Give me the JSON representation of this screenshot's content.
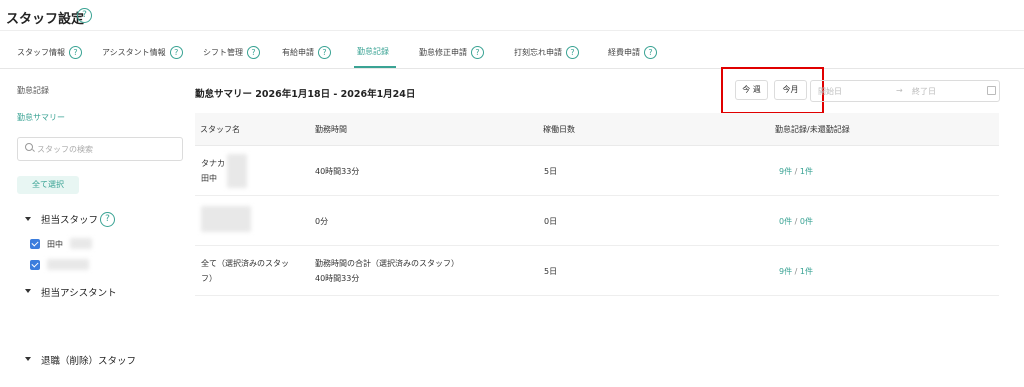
{
  "header": {
    "title": "スタッフ設定",
    "help": "?"
  },
  "tabs": [
    {
      "label": "スタッフ情報",
      "help": "?"
    },
    {
      "label": "アシスタント情報",
      "help": "?"
    },
    {
      "label": "シフト管理",
      "help": "?"
    },
    {
      "label": "有給申請",
      "help": "?"
    },
    {
      "label": "勤怠記録"
    },
    {
      "label": "勤怠修正申請",
      "help": "?"
    },
    {
      "label": "打刻忘れ申請",
      "help": "?"
    },
    {
      "label": "経費申請",
      "help": "?"
    }
  ],
  "sidebar": {
    "heading": "勤怠記録",
    "summary_link": "勤怠サマリー",
    "search_placeholder": "スタッフの検索",
    "select_all": "全て選択",
    "groups": {
      "staff": "担当スタッフ",
      "assistant": "担当アシスタント",
      "retired": "退職（削除）スタッフ"
    },
    "staff_items": [
      {
        "label": "田中"
      }
    ],
    "help": "?"
  },
  "main": {
    "summary_title": "勤怠サマリー 2026年1月18日 - 2026年1月24日",
    "range_buttons": {
      "this_week": "今 週",
      "this_month": "今月"
    },
    "date_range": {
      "start_placeholder": "開始日",
      "arrow": "→",
      "end_placeholder": "終了日"
    },
    "columns": [
      "スタッフ名",
      "勤務時間",
      "稼働日数",
      "勤怠記録/未還勤記録"
    ],
    "rows": [
      {
        "name_line1": "タナカ",
        "name_line2": "田中",
        "hours": "40時間33分",
        "hours_line2": "",
        "days": "5日",
        "rec": "9件",
        "sep": "/",
        "unrec": "1件"
      },
      {
        "name_line1": "",
        "name_line2": "",
        "hours": "0分",
        "hours_line2": "",
        "days": "0日",
        "rec": "0件",
        "sep": "/",
        "unrec": "0件"
      },
      {
        "name_line1": "全て（選択済みのスタッ",
        "name_line2": "フ）",
        "hours": "勤務時間の合計（選択済みのスタッフ）",
        "hours_line2": "40時間33分",
        "days": "5日",
        "rec": "9件",
        "sep": "/",
        "unrec": "1件"
      }
    ]
  },
  "colors": {
    "accent": "#3aa394",
    "checkbox": "#3b7ddd",
    "highlight": "#e00000"
  }
}
